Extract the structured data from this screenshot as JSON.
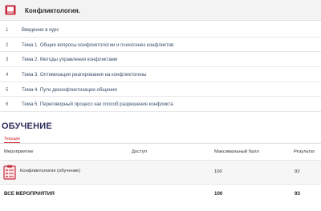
{
  "course": {
    "title": "Конфликтология.",
    "icon": "book-icon",
    "accent": "#c8283c"
  },
  "modules": [
    {
      "num": "1",
      "label": "Введение в курс"
    },
    {
      "num": "2",
      "label": "Тема 1. Общие вопросы конфликтологии и психогенез конфликтов"
    },
    {
      "num": "3",
      "label": "Тема 2. Методы управления конфликтами"
    },
    {
      "num": "4",
      "label": "Тема 3. Оптимизация реагирования на конфликтогены"
    },
    {
      "num": "5",
      "label": "Тема 4. Пути деконфликтизации общения"
    },
    {
      "num": "6",
      "label": "Тема 5. Переговорный процесс как способ разрешения конфликта"
    }
  ],
  "training": {
    "section_title": "ОБУЧЕНИЕ",
    "tab": "Текущие",
    "columns": {
      "activity": "Мероприятие",
      "access": "Доступ",
      "max_score": "Максимальный балл",
      "result": "Результат"
    },
    "rows": [
      {
        "icon": "checklist-icon",
        "name": "Конфликтология (обучение)",
        "max_score": "100",
        "result": "93"
      }
    ],
    "total": {
      "label": "ВСЕ МЕРОПРИЯТИЯ",
      "max_score": "100",
      "result": "93"
    }
  }
}
